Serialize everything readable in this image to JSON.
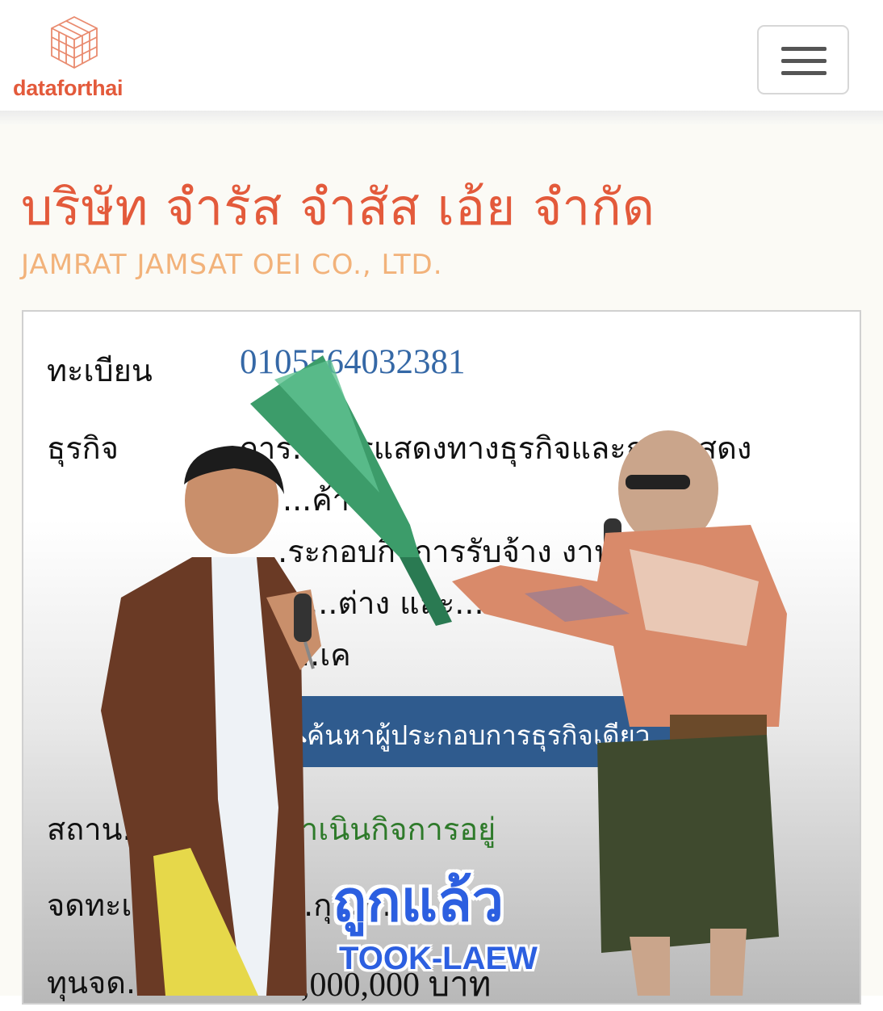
{
  "brand": {
    "name": "dataforthai",
    "logo_icon": "cube-grid-icon",
    "color": "#e35a3b"
  },
  "menu": {
    "icon": "hamburger-menu-icon"
  },
  "company": {
    "name_th": "บริษัท จำรัส จำสัส เอ้ย จำกัด",
    "name_en": "JAMRAT JAMSAT OEI CO., LTD."
  },
  "details": {
    "registration_label": "ทะเบียน",
    "registration_value": "0105564032381",
    "business_label": "ธุรกิจ",
    "business_lines": [
      "การ...การแสดงทางธุรกิจและการแสดง",
      "...ค้า",
      "...ระกอบกิจการรับจ้าง งานแสดง...อี",
      "...น...ต่าง และ...ายสิท...",
      "...เค"
    ],
    "search_button": "ค้นหาผู้ประกอบการธุรกิจเดียว",
    "search_icon": "search-icon",
    "status_label": "สถาน...",
    "status_value": "...ดำเนินกิจการอยู่",
    "registered_label": "จดทะเ...",
    "registered_value": "...กุมภ...",
    "capital_label": "ทุนจด...",
    "capital_value": "1,000,000 บาท"
  },
  "overlay": {
    "caption_th": "ถูกแล้ว",
    "caption_en": "TOOK-LAEW",
    "caption_color": "#2c5fe0"
  }
}
